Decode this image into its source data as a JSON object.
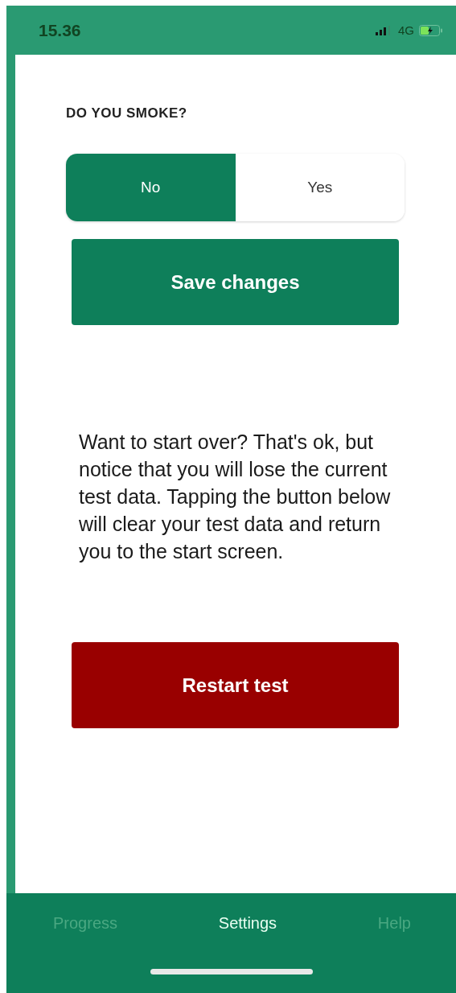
{
  "status_bar": {
    "time": "15.36",
    "network": "4G"
  },
  "question": {
    "label": "DO YOU SMOKE?",
    "options": [
      {
        "label": "No",
        "selected": true
      },
      {
        "label": "Yes",
        "selected": false
      }
    ]
  },
  "save_button": "Save changes",
  "notice": "Want to start over? That's ok, but notice that you will lose the current test data. Tapping the button below will clear your test data and return you to the start screen.",
  "restart_button": "Restart test",
  "tabs": [
    {
      "label": "Progress",
      "selected": false
    },
    {
      "label": "Settings",
      "selected": true
    },
    {
      "label": "Help",
      "selected": false
    }
  ]
}
